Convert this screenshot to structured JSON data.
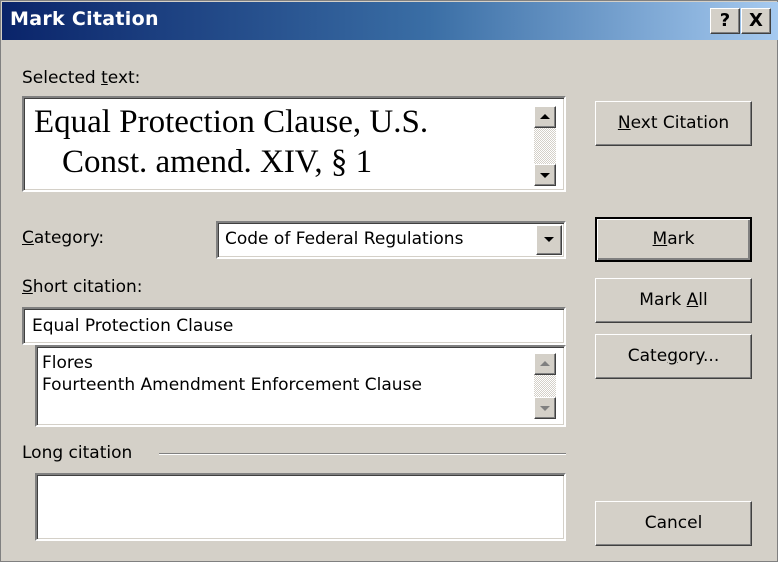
{
  "window": {
    "title": "Mark Citation",
    "help_label": "?",
    "close_label": "X"
  },
  "selected_text": {
    "label_pre": "Selected ",
    "label_key": "t",
    "label_post": "ext:",
    "lines": [
      "Equal Protection Clause, U.S.",
      "Const. amend. XIV, § 1"
    ]
  },
  "category": {
    "label_key": "C",
    "label_post": "ategory:",
    "value": "Code of Federal Regulations"
  },
  "short_citation": {
    "label_key": "S",
    "label_post": "hort citation:",
    "value": "Equal Protection Clause",
    "list": [
      "Flores",
      "Fourteenth Amendment Enforcement Clause"
    ]
  },
  "long_citation": {
    "label": "Long citation",
    "value": ""
  },
  "buttons": {
    "next_citation": {
      "key": "N",
      "post": "ext Citation"
    },
    "mark": {
      "key": "M",
      "post": "ark"
    },
    "mark_all": {
      "pre": "Mark ",
      "key": "A",
      "post": "ll"
    },
    "category": {
      "pre": "Cate",
      "key": "g",
      "post": "ory..."
    },
    "cancel": "Cancel"
  }
}
